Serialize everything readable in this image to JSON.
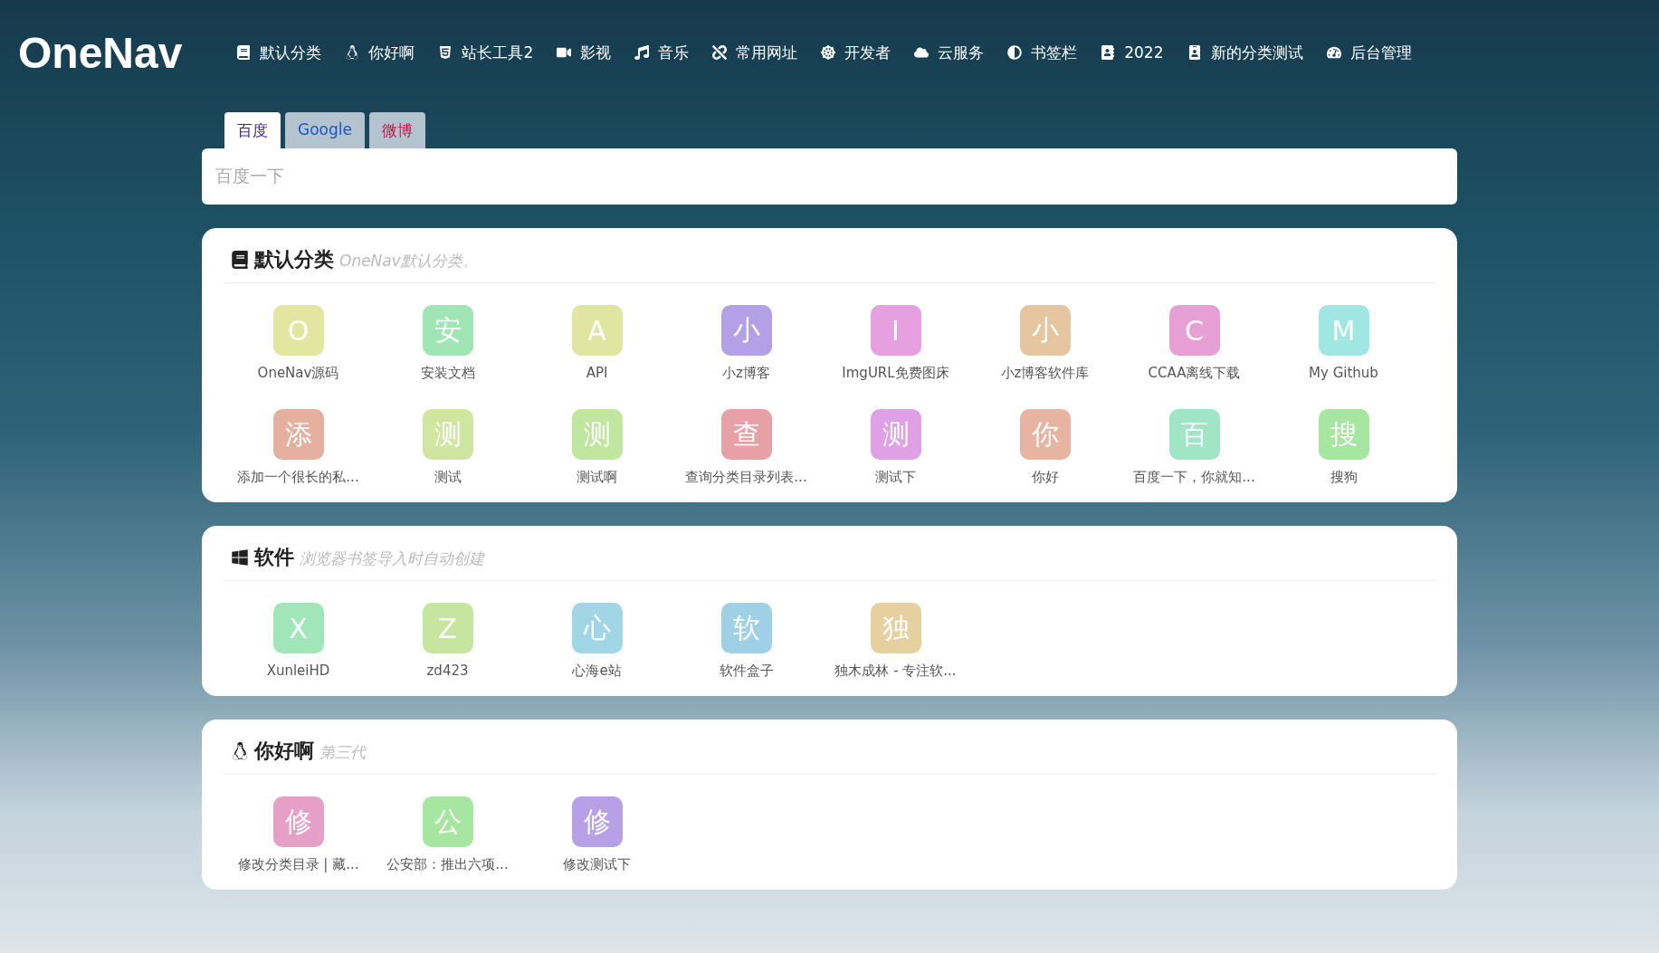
{
  "logo": "OneNav",
  "nav": [
    {
      "label": "默认分类"
    },
    {
      "label": "你好啊"
    },
    {
      "label": "站长工具2"
    },
    {
      "label": "影视"
    },
    {
      "label": "音乐"
    },
    {
      "label": "常用网址"
    },
    {
      "label": "开发者"
    },
    {
      "label": "云服务"
    },
    {
      "label": "书签栏"
    },
    {
      "label": "2022"
    },
    {
      "label": "新的分类测试"
    },
    {
      "label": "后台管理"
    }
  ],
  "search": {
    "tabs": [
      {
        "label": "百度",
        "selected": true
      },
      {
        "label": "Google",
        "selected": false
      },
      {
        "label": "微博",
        "selected": false
      }
    ],
    "placeholder": "百度一下"
  },
  "categories": [
    {
      "title": "默认分类",
      "description": "OneNav默认分类。",
      "links": [
        {
          "letter": "O",
          "name": "OneNav源码",
          "color": "#e3e6a0"
        },
        {
          "letter": "安",
          "name": "安装文档",
          "color": "#a0e6b4"
        },
        {
          "letter": "A",
          "name": "API",
          "color": "#e0e6a0"
        },
        {
          "letter": "小",
          "name": "小z博客",
          "color": "#b3a0e6"
        },
        {
          "letter": "I",
          "name": "ImgURL免费图床",
          "color": "#e6a0e0"
        },
        {
          "letter": "小",
          "name": "小z博客软件库",
          "color": "#e6c6a0"
        },
        {
          "letter": "C",
          "name": "CCAA离线下载",
          "color": "#e6a0d6"
        },
        {
          "letter": "M",
          "name": "My Github",
          "color": "#a0e6e3"
        },
        {
          "letter": "添",
          "name": "添加一个很长的私...",
          "color": "#e6b0a0"
        },
        {
          "letter": "测",
          "name": "测试",
          "color": "#d0e6a0"
        },
        {
          "letter": "测",
          "name": "测试啊",
          "color": "#c0e6a0"
        },
        {
          "letter": "查",
          "name": "查询分类目录列表...",
          "color": "#e6a0a6"
        },
        {
          "letter": "测",
          "name": "测试下",
          "color": "#e0a0e6"
        },
        {
          "letter": "你",
          "name": "你好",
          "color": "#e6b4a0"
        },
        {
          "letter": "百",
          "name": "百度一下，你就知...",
          "color": "#a0e6c6"
        },
        {
          "letter": "搜",
          "name": "搜狗",
          "color": "#a6e6a0"
        }
      ]
    },
    {
      "title": "软件",
      "description": "浏览器书签导入时自动创建",
      "links": [
        {
          "letter": "X",
          "name": "XunleiHD",
          "color": "#a0e6b8"
        },
        {
          "letter": "Z",
          "name": "zd423",
          "color": "#c6e6a0"
        },
        {
          "letter": "心",
          "name": "心海e站",
          "color": "#a0d6e6"
        },
        {
          "letter": "软",
          "name": "软件盒子",
          "color": "#a0d0e6"
        },
        {
          "letter": "独",
          "name": "独木成林 - 专注软...",
          "color": "#e6d0a0"
        }
      ]
    },
    {
      "title": "你好啊",
      "description": "第三代",
      "links": [
        {
          "letter": "修",
          "name": "修改分类目录 | 藏...",
          "color": "#e6a0c8"
        },
        {
          "letter": "公",
          "name": "公安部：推出六项...",
          "color": "#a6e6a0"
        },
        {
          "letter": "修",
          "name": "修改测试下",
          "color": "#b8a0e6"
        }
      ]
    }
  ]
}
